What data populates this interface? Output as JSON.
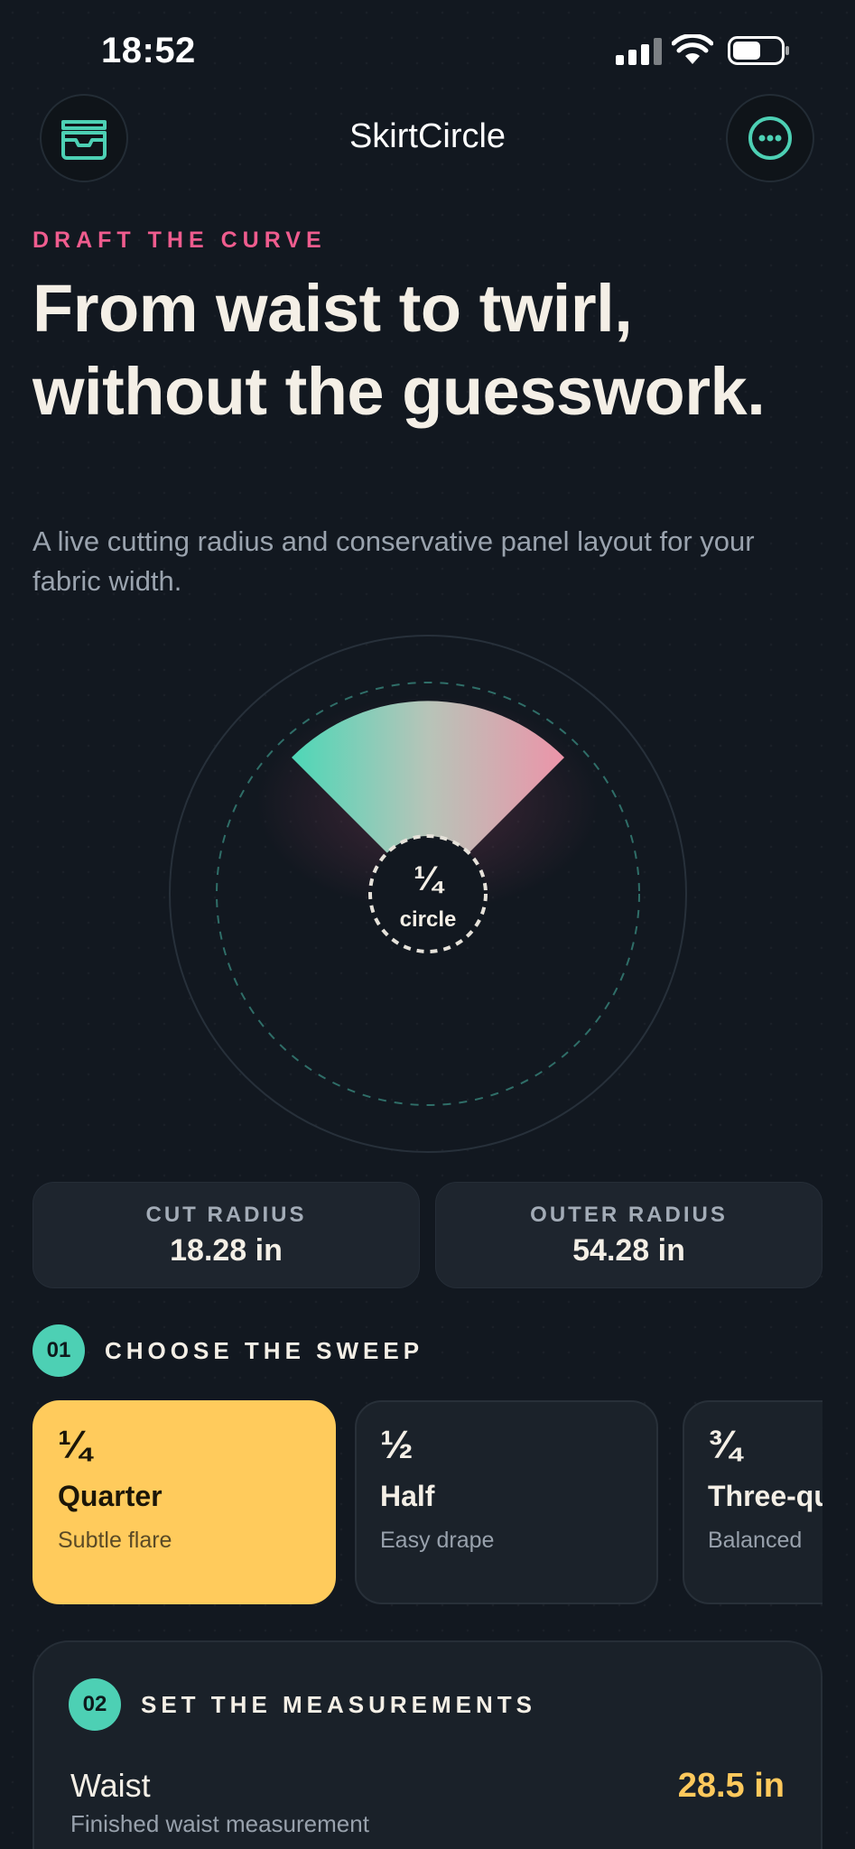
{
  "status_bar": {
    "time": "18:52"
  },
  "app": {
    "title": "SkirtCircle"
  },
  "hero": {
    "eyebrow": "DRAFT THE CURVE",
    "headline": "From waist to twirl, without the guesswork.",
    "subtitle": "A live cutting radius and conservative panel layout for your fabric width."
  },
  "dial": {
    "fraction": "¼",
    "label": "circle"
  },
  "stats": [
    {
      "label": "CUT RADIUS",
      "value": "18.28 in"
    },
    {
      "label": "OUTER RADIUS",
      "value": "54.28 in"
    }
  ],
  "sweep_section": {
    "number": "01",
    "title": "CHOOSE THE SWEEP",
    "options": [
      {
        "fraction": "¼",
        "name": "Quarter",
        "desc": "Subtle flare",
        "selected": true
      },
      {
        "fraction": "½",
        "name": "Half",
        "desc": "Easy drape",
        "selected": false
      },
      {
        "fraction": "¾",
        "name": "Three-quarter",
        "desc": "Balanced",
        "selected": false
      }
    ]
  },
  "measure_section": {
    "number": "02",
    "title": "SET THE MEASUREMENTS",
    "items": [
      {
        "label": "Waist",
        "sub": "Finished waist measurement",
        "value": "28.5 in"
      }
    ]
  },
  "colors": {
    "background": "#121820",
    "accent_teal": "#4DD0B4",
    "accent_pink": "#EF5C8E",
    "accent_yellow": "#FFCB5C"
  },
  "icons": {
    "left_button": "inbox-tray-icon",
    "right_button": "more-dots-icon"
  }
}
